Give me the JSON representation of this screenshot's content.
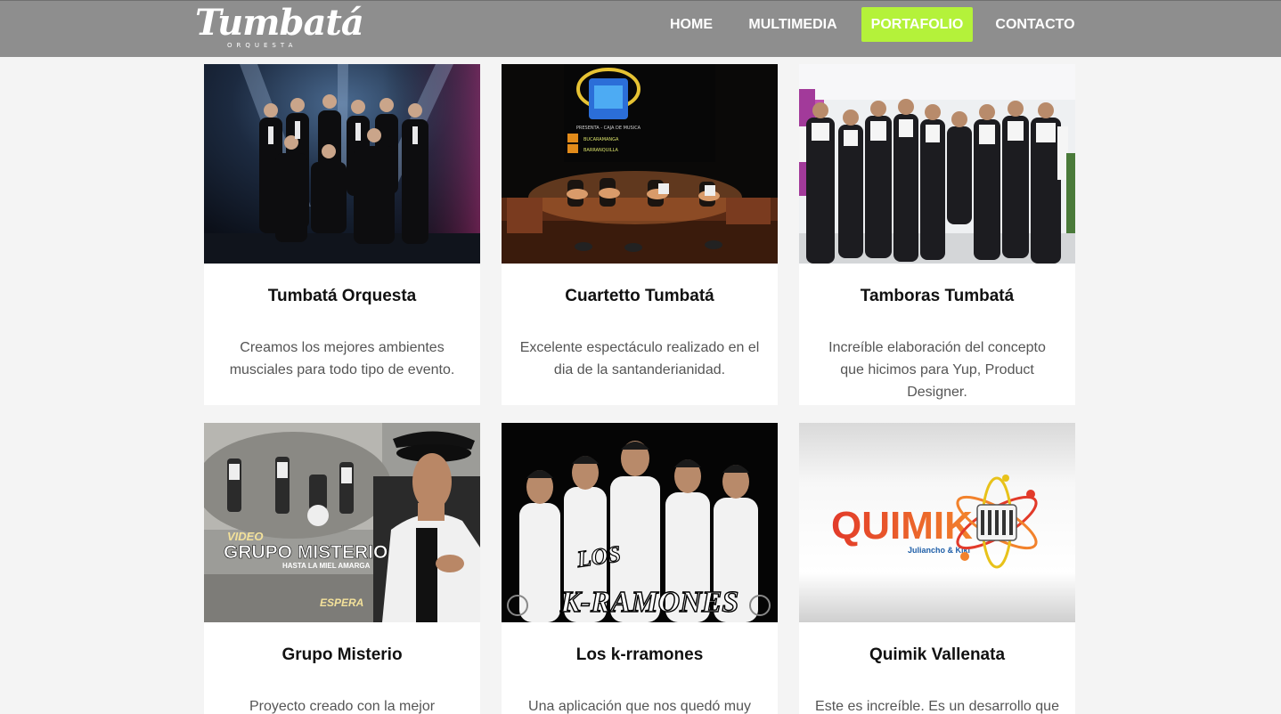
{
  "header": {
    "logo_text": "Tumbatá",
    "logo_subtext": "ORQUESTA",
    "nav": [
      {
        "label": "HOME"
      },
      {
        "label": "MULTIMEDIA"
      },
      {
        "label": "PORTAFOLIO",
        "active": true
      },
      {
        "label": "CONTACTO"
      }
    ],
    "active_color": "#b4f23a"
  },
  "cards": [
    {
      "title": "Tumbatá Orquesta",
      "description": "Creamos los mejores ambientes musciales para todo tipo de evento."
    },
    {
      "title": "Cuartetto Tumbatá",
      "description": "Excelente espectáculo realizado en el dia de la santanderianidad."
    },
    {
      "title": "Tamboras Tumbatá",
      "description": "Increíble elaboración del concepto que hicimos para Yup, Product Designer."
    },
    {
      "title": "Grupo Misterio",
      "description": "Proyecto creado con la mejor tecnología",
      "image_text": {
        "line1": "VIDEO",
        "line2": "GRUPO MISTERIO",
        "line3": "HASTA LA MIEL AMARGA",
        "line4": "ESPERA"
      }
    },
    {
      "title": "Los k-rramones",
      "description": "Una aplicación que nos quedó muy",
      "image_text": {
        "line1": "LOS",
        "line2": "K-RAMONES"
      }
    },
    {
      "title": "Quimik Vallenata",
      "description": "Este es increíble. Es un desarrollo que",
      "image_text": {
        "line1": "QUIMIK",
        "line2": "Juliancho & Kiki"
      }
    }
  ],
  "poster_text": {
    "line1": "PRESENTA - CAJA DE MUSICA",
    "line2": "BUCARAMANGA",
    "line3": "BARRANQUILLA"
  }
}
